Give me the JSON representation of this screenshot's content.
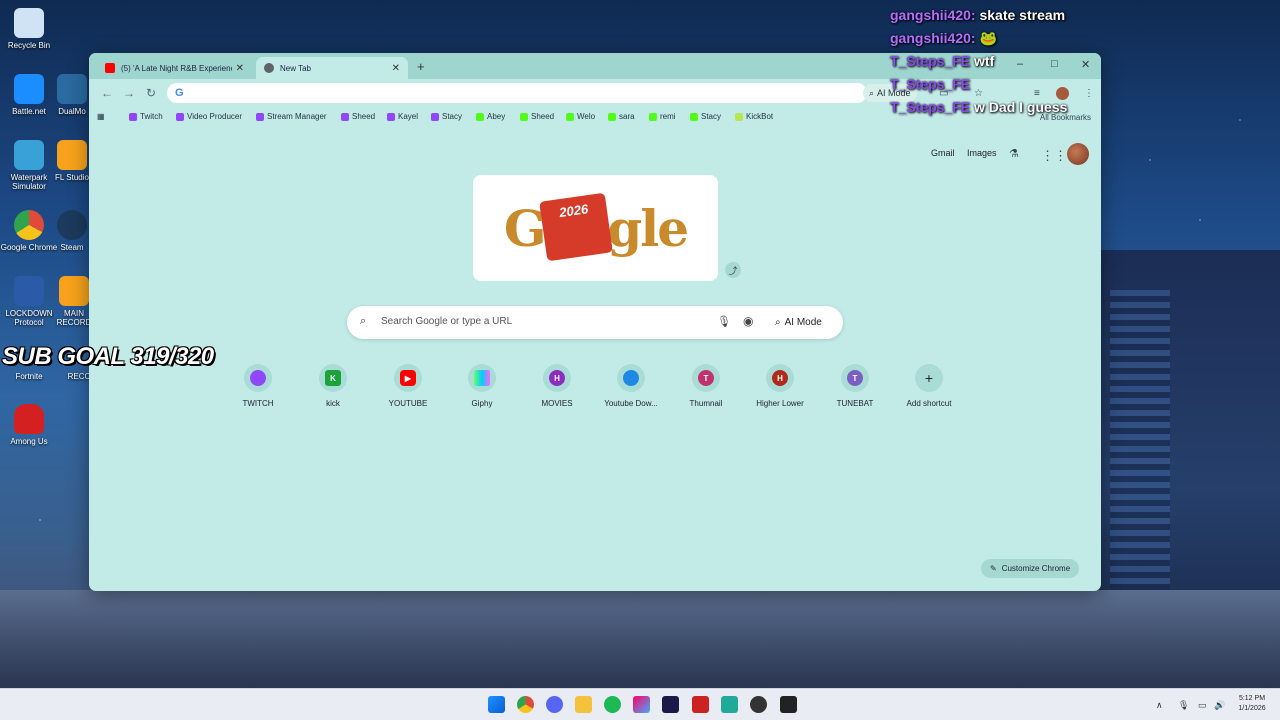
{
  "desktop": {
    "icons": [
      {
        "label": "Recycle Bin",
        "color": "#cfe3f5"
      },
      {
        "label": "Battle.net",
        "color": "#1a8dff"
      },
      {
        "label": "DualMo",
        "color": "#2a6aa0"
      },
      {
        "label": "Waterpark Simulator",
        "color": "#3aa0d8"
      },
      {
        "label": "FL Studio",
        "color": "#f7a21a"
      },
      {
        "label": "Google Chrome",
        "color": "#e04a3a"
      },
      {
        "label": "Steam",
        "color": "#1b3a5c"
      },
      {
        "label": "LOCKDOWN Protocol",
        "color": "#2a5aa8"
      },
      {
        "label": "MAIN RECORD",
        "color": "#f7a21a"
      },
      {
        "label": "Fortnite",
        "color": "#4a6fd0"
      },
      {
        "label": "RECC",
        "color": "#777"
      },
      {
        "label": "Among Us",
        "color": "#d42020"
      }
    ],
    "sub_goal": "SUB GOAL 319/320"
  },
  "chat": [
    {
      "user": "gangshii420:",
      "message": "skate stream",
      "user_color": "#b66cff"
    },
    {
      "user": "gangshii420:",
      "message": "🐸",
      "user_color": "#b66cff"
    },
    {
      "user": "T_Steps_FE",
      "message": "wtf",
      "user_color": "#8a48f2"
    },
    {
      "user": "T_Steps_FE",
      "message": "",
      "user_color": "#8a48f2"
    },
    {
      "user": "T_Steps_FE",
      "message": "w Dad I guess",
      "user_color": "#8a48f2"
    }
  ],
  "browser": {
    "tabs": [
      {
        "title": "(5) 'A Late Night R&B Experienc",
        "active": false,
        "favicon_color": "#ff0000"
      },
      {
        "title": "New Tab",
        "active": true,
        "favicon_color": "#5f6368"
      }
    ],
    "window_controls": {
      "minimize": "–",
      "maximize": "□",
      "close": "✕"
    },
    "omnibox_value": "",
    "ai_mode_label": "AI Mode",
    "bookmarks": [
      {
        "label": "Twitch",
        "icon_color": "#9146ff"
      },
      {
        "label": "Video Producer",
        "icon_color": "#9146ff"
      },
      {
        "label": "Stream Manager",
        "icon_color": "#9146ff"
      },
      {
        "label": "Sheed",
        "icon_color": "#9146ff"
      },
      {
        "label": "Kayel",
        "icon_color": "#9146ff"
      },
      {
        "label": "Stacy",
        "icon_color": "#9146ff"
      },
      {
        "label": "Abey",
        "icon_color": "#53fc18"
      },
      {
        "label": "Sheed",
        "icon_color": "#53fc18"
      },
      {
        "label": "Welo",
        "icon_color": "#53fc18"
      },
      {
        "label": "sara",
        "icon_color": "#53fc18"
      },
      {
        "label": "remi",
        "icon_color": "#53fc18"
      },
      {
        "label": "Stacy",
        "icon_color": "#53fc18"
      },
      {
        "label": "KickBot",
        "icon_color": "#b5e853"
      }
    ],
    "all_bookmarks": "All Bookmarks",
    "top_links": {
      "gmail": "Gmail",
      "images": "Images"
    },
    "doodle": {
      "word": "Google",
      "year": "2026"
    },
    "search": {
      "placeholder": "Search Google or type a URL",
      "ai_mode": "AI Mode"
    },
    "shortcuts": [
      {
        "title": "TWITCH",
        "letter": "",
        "color": "#9146ff"
      },
      {
        "title": "kick",
        "letter": "K",
        "color": "#1aa33a"
      },
      {
        "title": "YOUTUBE",
        "letter": "▶",
        "color": "#ff0000"
      },
      {
        "title": "Giphy",
        "letter": "",
        "color": "#6f6"
      },
      {
        "title": "MOVIES",
        "letter": "H",
        "color": "#8e2cc0"
      },
      {
        "title": "Youtube Dow...",
        "letter": "",
        "color": "#1e88e5"
      },
      {
        "title": "Thumnail",
        "letter": "T",
        "color": "#c0316e"
      },
      {
        "title": "Higher Lower",
        "letter": "H",
        "color": "#b02a1c"
      },
      {
        "title": "TUNEBAT",
        "letter": "T",
        "color": "#7a5fc0"
      },
      {
        "title": "Add shortcut",
        "letter": "+",
        "color": "transparent"
      }
    ],
    "customize": "Customize Chrome"
  },
  "taskbar": {
    "clock_time": "5:12 PM",
    "clock_date": "1/1/2026"
  }
}
